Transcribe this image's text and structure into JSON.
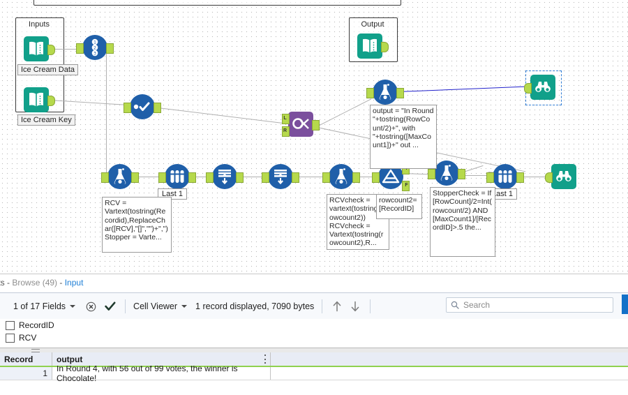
{
  "canvas": {
    "containers": [
      {
        "name": "inputs-container",
        "title": "Inputs"
      },
      {
        "name": "output-container",
        "title": "Output"
      }
    ],
    "tool_labels": [
      {
        "name": "ice-cream-data-label",
        "text": "Ice Cream Data"
      },
      {
        "name": "ice-cream-key-label",
        "text": "Ice Cream Key"
      }
    ],
    "annotations": [
      {
        "name": "formula-annotation-output",
        "text": "output = \"In Round \"+tostring(RowCount/2)+\", with \"+tostring([MaxCount1])+\" out ..."
      },
      {
        "name": "formula-annotation-rcv",
        "text": "RCV = Vartext(tostring(Recordid),ReplaceChar([RCV],\"[]\",\"\")+\",\") Stopper = Varte..."
      },
      {
        "name": "formula-annotation-rcvcheck",
        "text": "RCVcheck = vartext(tostring(rowcount2)) RCVcheck = Vartext(tostring(rowcount2),R..."
      },
      {
        "name": "formula-annotation-rowcount2",
        "text": "rowcount2=[RecordID]"
      },
      {
        "name": "formula-annotation-stoppercheck",
        "text": "StopperCheck = If [RowCount]/2=Int(rowcount/2) AND [MaxCount1]/[RecordID]>.5 the..."
      }
    ],
    "badges": [
      {
        "name": "sample-badge-1",
        "text": "Last 1"
      },
      {
        "name": "sample-badge-2",
        "text": "Last 1"
      }
    ],
    "anchor_labels": {
      "true": "T",
      "false": "F",
      "left": "L",
      "right": "R"
    },
    "colors": {
      "tool_blue": "#1f5fa9",
      "tool_teal": "#11a08a",
      "tool_purple": "#7b4f9d",
      "anchor_green": "#b6d94c",
      "selected_wire": "#2222cc",
      "selection_outline": "#2e7bd4"
    },
    "tools": [
      {
        "name": "tool-input-ice-cream-data",
        "icon": "input-data-icon"
      },
      {
        "name": "tool-input-ice-cream-key",
        "icon": "input-data-icon"
      },
      {
        "name": "tool-output-data",
        "icon": "output-data-icon"
      },
      {
        "name": "tool-record-id",
        "icon": "record-id-icon"
      },
      {
        "name": "tool-select",
        "icon": "select-check-icon"
      },
      {
        "name": "tool-join",
        "icon": "join-icon"
      },
      {
        "name": "tool-formula-top",
        "icon": "formula-flask-icon"
      },
      {
        "name": "tool-browse-selected",
        "icon": "browse-binoculars-icon"
      },
      {
        "name": "tool-formula-1",
        "icon": "formula-flask-icon"
      },
      {
        "name": "tool-sample-1",
        "icon": "sample-tubes-icon"
      },
      {
        "name": "tool-union-1",
        "icon": "union-icon"
      },
      {
        "name": "tool-union-2",
        "icon": "union-icon"
      },
      {
        "name": "tool-formula-2",
        "icon": "formula-flask-icon"
      },
      {
        "name": "tool-filter",
        "icon": "filter-funnel-icon"
      },
      {
        "name": "tool-formula-3",
        "icon": "formula-flask-icon"
      },
      {
        "name": "tool-sample-2",
        "icon": "sample-tubes-icon"
      },
      {
        "name": "tool-browse-end",
        "icon": "browse-binoculars-icon"
      }
    ]
  },
  "results": {
    "tab": {
      "prefix": "ults",
      "separator_1": " - ",
      "browse": "Browse (49)",
      "separator_2": " - ",
      "suffix": "Input"
    },
    "toolbar": {
      "fields_label": "1 of 17 Fields",
      "cell_viewer_label": "Cell Viewer",
      "record_status": "1 record displayed, 7090 bytes",
      "clear_icon": "clear-circle-x-icon",
      "check_icon": "checkmark-icon",
      "up_icon": "arrow-up-icon",
      "down_icon": "arrow-down-icon"
    },
    "search": {
      "placeholder": "Search",
      "value": "",
      "icon": "search-icon"
    },
    "fields": [
      {
        "name": "RecordID",
        "checked": false
      },
      {
        "name": "RCV",
        "checked": false
      }
    ],
    "grid": {
      "columns": [
        "Record",
        "output"
      ],
      "rows": [
        {
          "record": "1",
          "output": "In Round 4, with 56 out of 99 votes, the winner is Chocolate!"
        }
      ]
    }
  }
}
